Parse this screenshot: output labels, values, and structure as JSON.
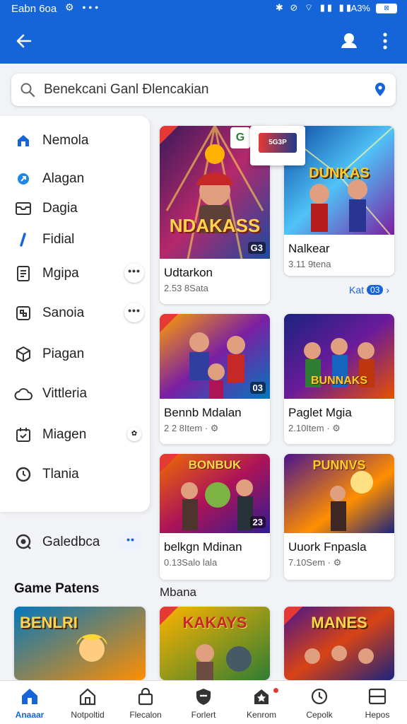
{
  "status_bar": {
    "time": "Εabn 6oa",
    "left_icons": "⚙ •••",
    "right_icons": "✱ ⊘ ⌔ ▮▮ ▮▮",
    "battery_text": "A3%",
    "battery_label": "⊠"
  },
  "app_bar": {
    "back_icon": "arrow-left-icon",
    "profile_icon": "user-icon",
    "more_icon": "more-vertical-icon"
  },
  "search": {
    "value": "Benekcani Ganl Ðlencakian"
  },
  "sidebar": {
    "items": [
      {
        "label": "Nemola",
        "icon": "home-icon"
      },
      {
        "label": "Alagan",
        "icon": "pin-icon"
      },
      {
        "label": "Dagia",
        "icon": "inbox-icon"
      },
      {
        "label": "Fidial",
        "icon": "marker-icon"
      },
      {
        "label": "Mgiра",
        "icon": "document-icon",
        "action": "•••"
      },
      {
        "label": "Sanoia",
        "icon": "grid-icon",
        "action": "•••"
      },
      {
        "label": "Piagan",
        "icon": "box-icon"
      },
      {
        "label": "Vittleria",
        "icon": "cloud-icon"
      },
      {
        "label": "Miagen",
        "icon": "calendar-icon",
        "action": "✿"
      },
      {
        "label": "Tlania",
        "icon": "clock-icon"
      }
    ],
    "gallery": {
      "label": "Galedbca",
      "action": "••"
    }
  },
  "sections": {
    "left_title": "Game Patens",
    "right_title": "Mbana"
  },
  "cards": [
    {
      "name": "Udtarkon",
      "meta": "2.53 8Sata",
      "art_text": "NDAKASS",
      "badge": "G3"
    },
    {
      "name": "Nalkear",
      "meta": "3.11 9tena",
      "art_text": "DUNKAS"
    },
    {
      "name": "Bennb Mdalan",
      "meta": "2 2 8Item · ⚙",
      "art_text": "",
      "badge": "03"
    },
    {
      "name": "Paglet Mgia",
      "meta": "2.10Item · ⚙",
      "art_text": "BUNNAKS"
    },
    {
      "name": "belkgn Mdinan",
      "meta": "0.13Salo lala",
      "art_text": "BONBUK",
      "badge": "23"
    },
    {
      "name": "Uuork Fnpasla",
      "meta": "7.10Sem · ⚙",
      "art_text": "PUNNVS"
    },
    {
      "name": "",
      "meta": "",
      "art_text": "BENLRI"
    },
    {
      "name": "",
      "meta": "",
      "art_text": "KAKAYS"
    },
    {
      "name": "",
      "meta": "",
      "art_text": "MANES"
    }
  ],
  "float_badge": "5G3P",
  "share_chip": "G",
  "more_link": {
    "label": "Kat",
    "count": "03",
    "chevron": "›"
  },
  "bottom_nav": [
    {
      "label": "Anaaar",
      "icon": "home-icon",
      "active": true
    },
    {
      "label": "Notpoltid",
      "icon": "house-outline-icon"
    },
    {
      "label": "Flecalon",
      "icon": "lock-icon"
    },
    {
      "label": "Forlert",
      "icon": "shield-icon"
    },
    {
      "label": "Kenrom",
      "icon": "star-box-icon",
      "dot": true
    },
    {
      "label": "Cepolk",
      "icon": "clock-icon"
    },
    {
      "label": "Hepos",
      "icon": "layout-icon"
    }
  ],
  "colors": {
    "primary": "#1565d8",
    "accent_red": "#e53935"
  }
}
